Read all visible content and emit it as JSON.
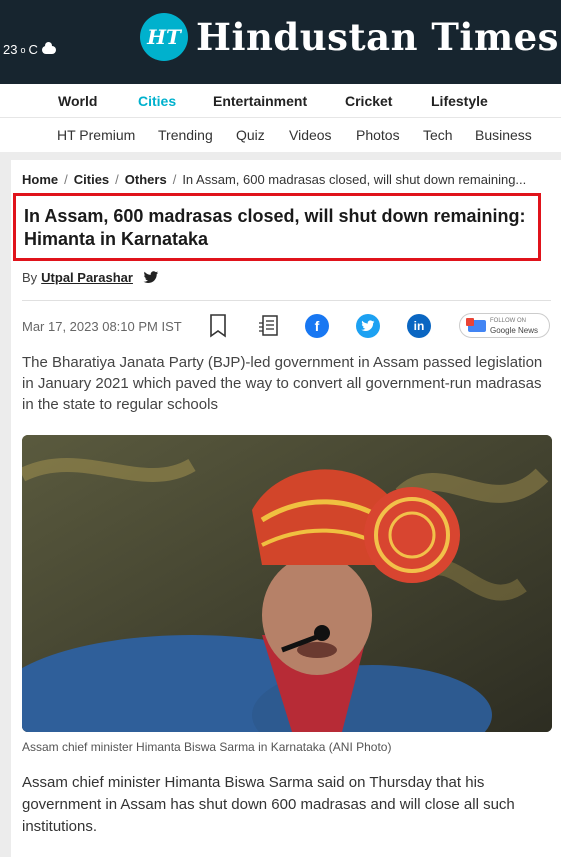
{
  "weather": {
    "temp": "23",
    "unit": "C"
  },
  "brand": {
    "logo_mark": "HT",
    "name": "Hindustan Times"
  },
  "nav_primary": [
    {
      "label": "World",
      "active": false
    },
    {
      "label": "Cities",
      "active": true
    },
    {
      "label": "Entertainment",
      "active": false
    },
    {
      "label": "Cricket",
      "active": false
    },
    {
      "label": "Lifestyle",
      "active": false
    }
  ],
  "nav_secondary": [
    "HT Premium",
    "Trending",
    "Quiz",
    "Videos",
    "Photos",
    "Tech",
    "Business"
  ],
  "breadcrumb": {
    "home": "Home",
    "cities": "Cities",
    "others": "Others",
    "current": "In Assam, 600 madrasas closed, will shut down remaining..."
  },
  "article": {
    "headline": "In Assam, 600 madrasas closed, will shut down remaining: Himanta in Karnataka",
    "by": "By",
    "author": "Utpal Parashar",
    "date": "Mar 17, 2023 08:10 PM IST",
    "summary": "The Bharatiya Janata Party (BJP)-led government in Assam passed legislation in January 2021 which paved the way to convert all government-run madrasas in the state to regular schools",
    "caption": "Assam chief minister Himanta Biswa Sarma in Karnataka (ANI Photo)",
    "body": "Assam chief minister Himanta Biswa Sarma said on Thursday that his government in Assam has shut down 600 madrasas and will close all such institutions."
  },
  "share": {
    "facebook_glyph": "f",
    "linkedin_glyph": "in",
    "google_news_small": "FOLLOW ON",
    "google_news_label": "Google News"
  },
  "colors": {
    "topbar": "#17252f",
    "accent": "#00b1cd",
    "highlight_box": "#e0131b"
  }
}
